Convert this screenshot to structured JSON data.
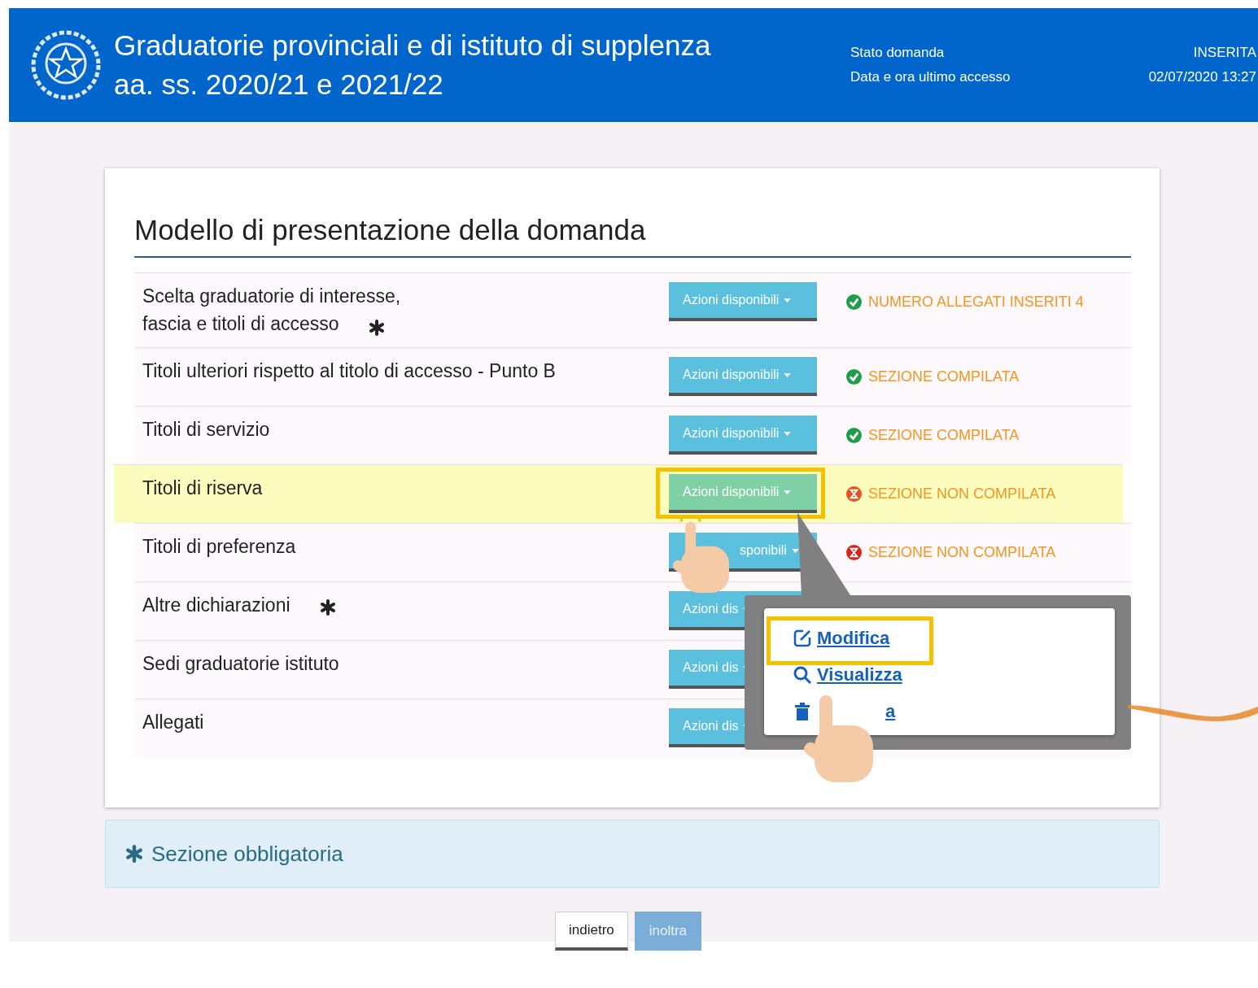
{
  "header": {
    "title_lines": [
      "Graduatorie provinciali e di istituto di supplenza",
      "aa. ss. 2020/21 e 2021/22"
    ],
    "info": [
      {
        "label": "Stato domanda",
        "value": "INSERITA"
      },
      {
        "label": "Data e ora ultimo accesso",
        "value": "02/07/2020 13:27"
      }
    ]
  },
  "card": {
    "title": "Modello di presentazione della domanda",
    "sections": [
      {
        "label_lines": [
          "Scelta graduatorie di interesse,",
          "fascia e titoli di accesso"
        ],
        "required": true,
        "button": "Azioni disponibili",
        "status": {
          "kind": "done",
          "text": "NUMERO ALLEGATI INSERITI 4"
        },
        "highlighted": false
      },
      {
        "label_lines": [
          "Titoli ulteriori rispetto al titolo di accesso - Punto B"
        ],
        "required": false,
        "button": "Azioni disponibili",
        "status": {
          "kind": "done",
          "text": "SEZIONE COMPILATA"
        },
        "highlighted": false
      },
      {
        "label_lines": [
          "Titoli di servizio"
        ],
        "required": false,
        "button": "Azioni disponibili",
        "status": {
          "kind": "done",
          "text": "SEZIONE COMPILATA"
        },
        "highlighted": false
      },
      {
        "label_lines": [
          "Titoli di riserva"
        ],
        "required": false,
        "button": "Azioni disponibili",
        "status": {
          "kind": "todo",
          "text": "SEZIONE NON COMPILATA"
        },
        "highlighted": true
      },
      {
        "label_lines": [
          "Titoli di preferenza"
        ],
        "required": false,
        "button": "sponibili",
        "button_covered": true,
        "status": {
          "kind": "missing",
          "text": "SEZIONE NON COMPILATA"
        },
        "highlighted": false
      },
      {
        "label_lines": [
          "Altre dichiarazioni"
        ],
        "required": true,
        "button": "Azioni dis",
        "highlighted": false
      },
      {
        "label_lines": [
          "Sedi graduatorie istituto"
        ],
        "required": false,
        "button": "Azioni dis",
        "highlighted": false
      },
      {
        "label_lines": [
          "Allegati"
        ],
        "required": false,
        "button": "Azioni dis",
        "highlighted": false
      }
    ]
  },
  "callout": {
    "menu": [
      {
        "kind": "edit",
        "label": "Modifica",
        "highlighted": true
      },
      {
        "kind": "view",
        "label": "Visualizza",
        "highlighted": false
      },
      {
        "kind": "delete",
        "label": "a",
        "highlighted": false
      }
    ]
  },
  "note": {
    "text": "Sezione obbligatoria"
  },
  "actions": [
    {
      "label": "indietro",
      "kind": "secondary"
    },
    {
      "label": "inoltra",
      "kind": "primary"
    }
  ]
}
